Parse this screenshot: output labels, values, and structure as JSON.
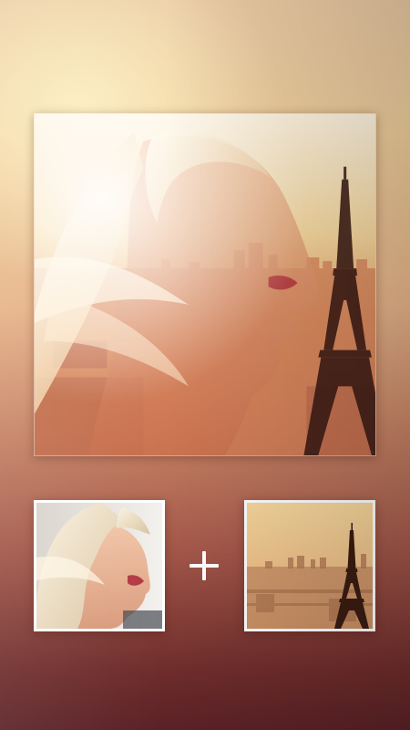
{
  "screen": {
    "name": "double-exposure-preview",
    "colors": {
      "background_top": "#f0cf9c",
      "background_bottom": "#5a2126",
      "frame_border": "#ffffff",
      "plus_sign": "#ffffff"
    }
  },
  "result_image": {
    "depicts": "double-exposure-portrait-paris-skyline"
  },
  "source_images": [
    {
      "depicts": "woman-portrait"
    },
    {
      "depicts": "paris-eiffel-tower-cityscape"
    }
  ],
  "operator_icon": "plus-icon"
}
